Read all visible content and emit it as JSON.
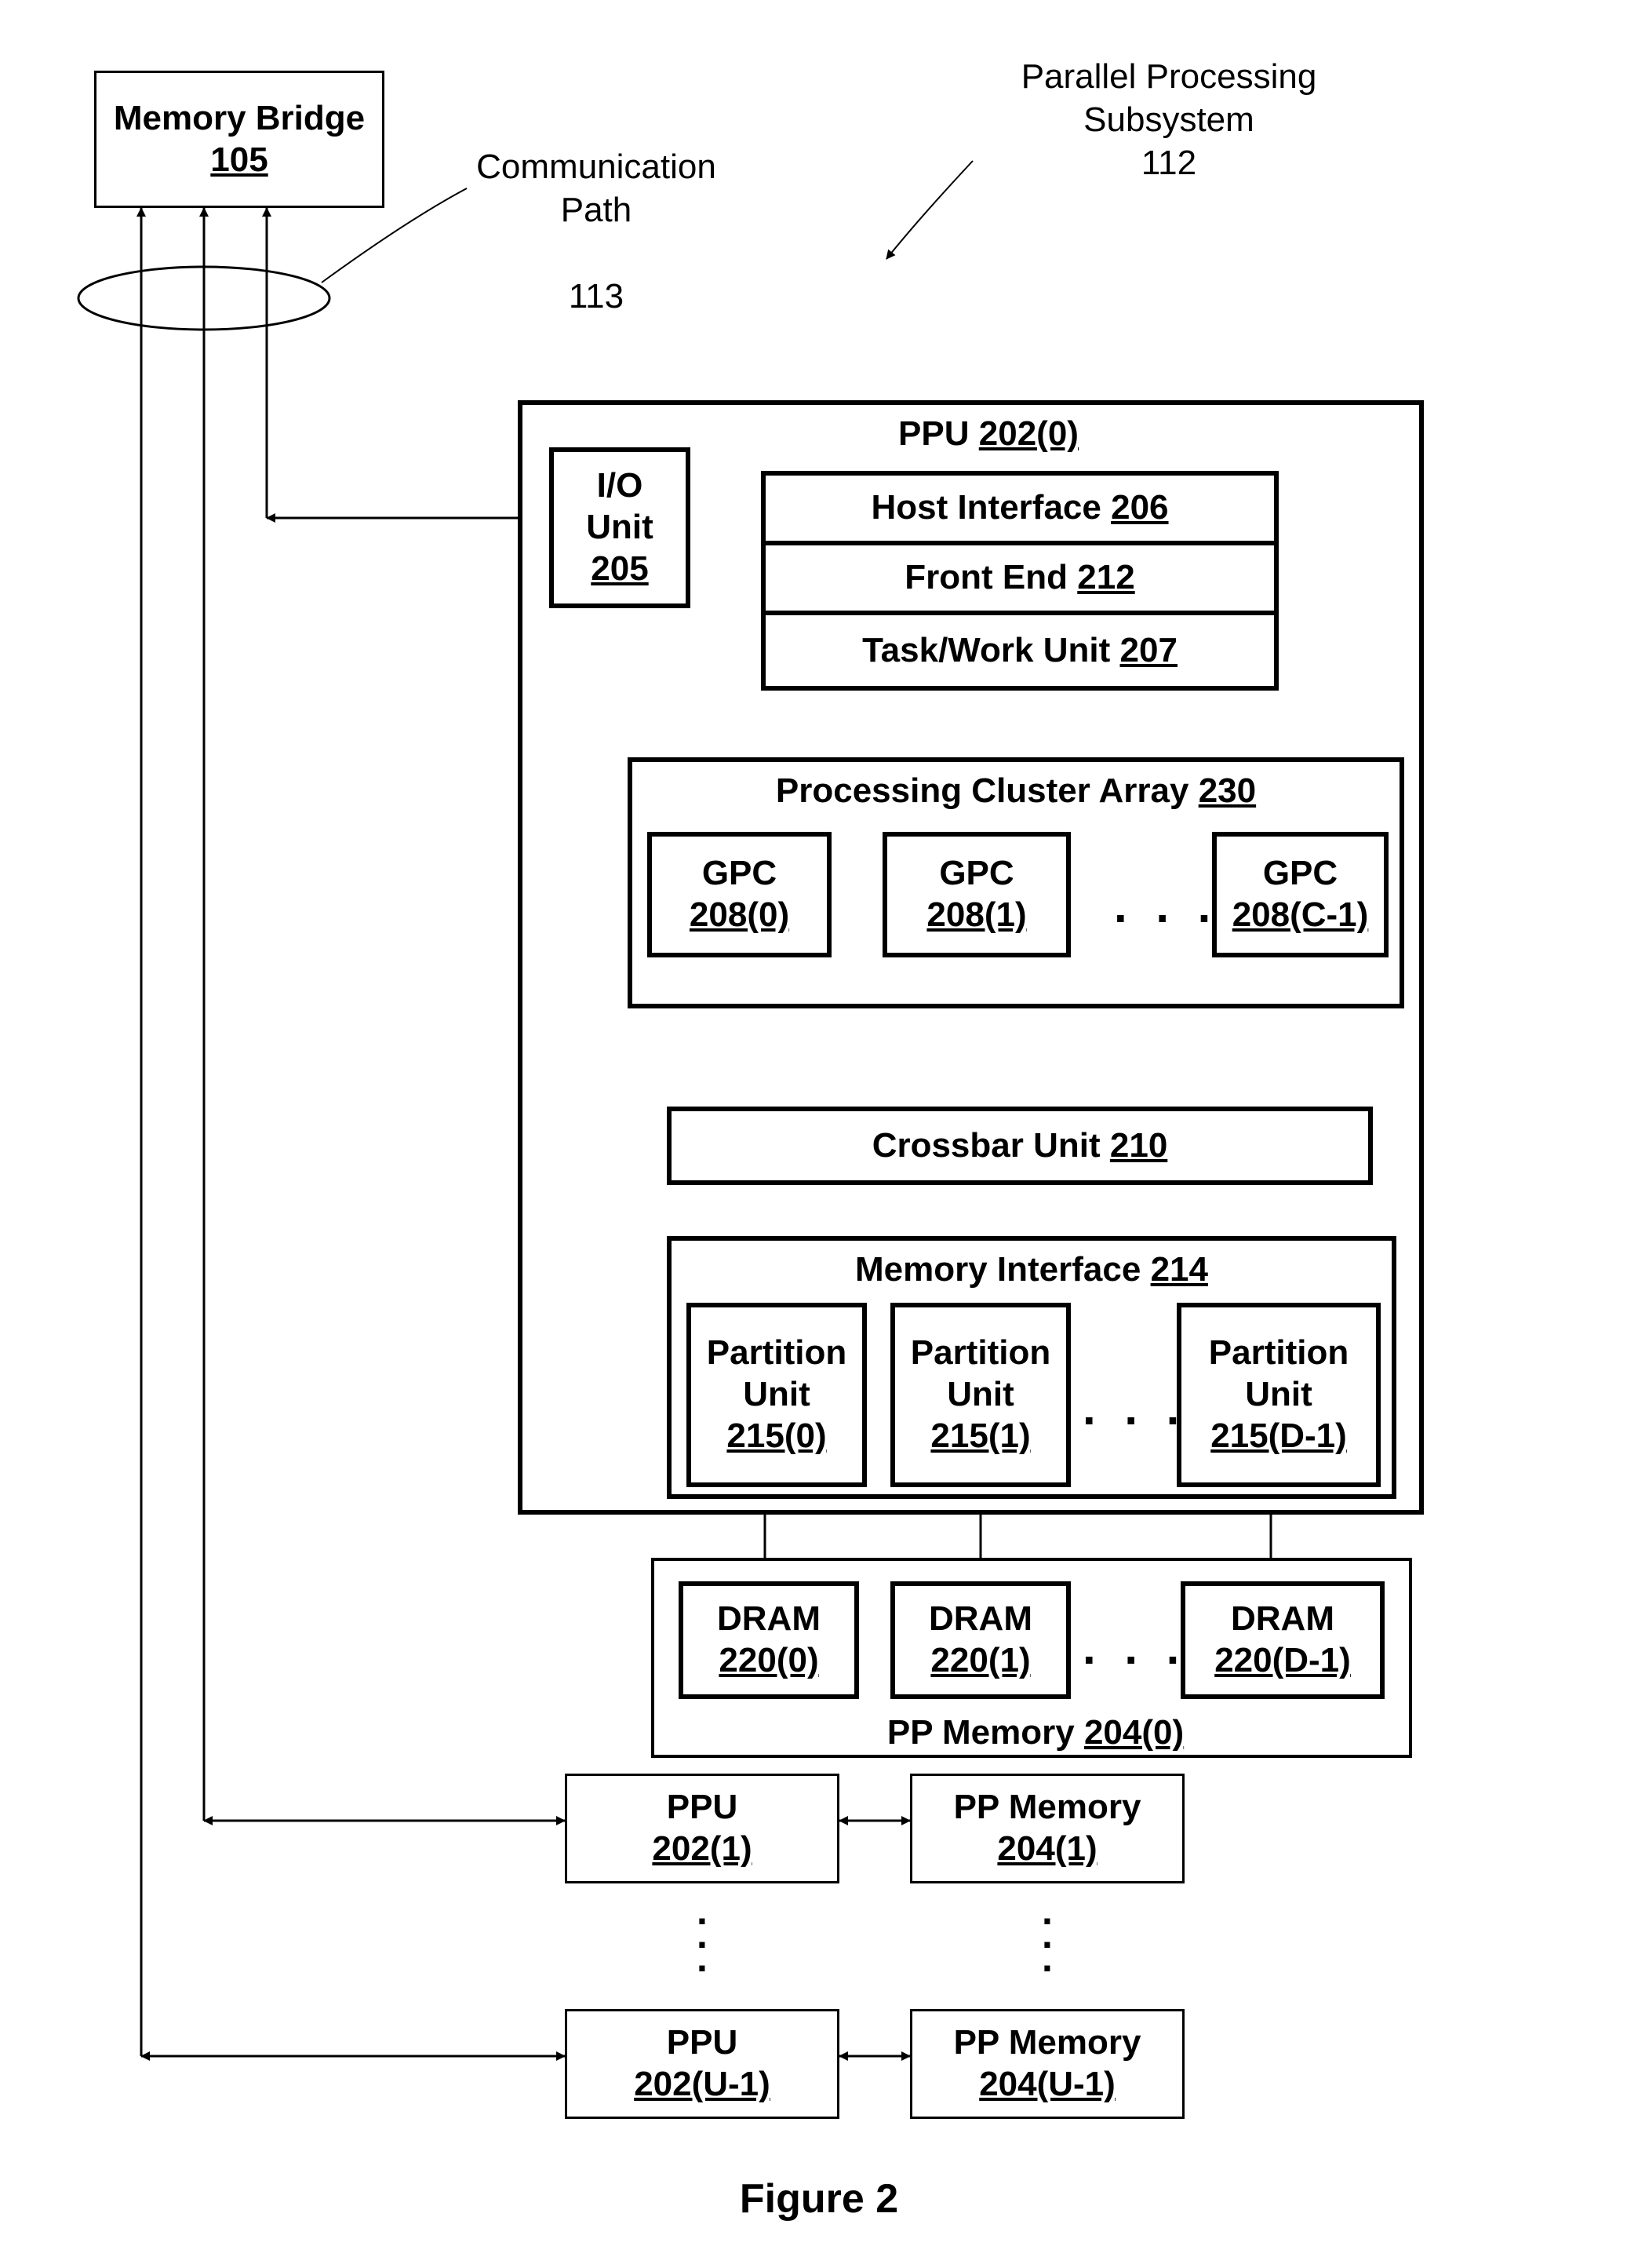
{
  "title": "Figure 2",
  "memory_bridge": {
    "name": "Memory Bridge",
    "ref": "105"
  },
  "comm_path": {
    "name": "Communication\nPath",
    "ref": "113"
  },
  "subsystem": {
    "name": "Parallel Processing\nSubsystem",
    "ref": "112"
  },
  "ppu0": {
    "name": "PPU",
    "ref": "202(0)",
    "io_unit": {
      "name": "I/O\nUnit",
      "ref": "205"
    },
    "host_interface": {
      "name": "Host Interface",
      "ref": "206"
    },
    "front_end": {
      "name": "Front End",
      "ref": "212"
    },
    "task_work": {
      "name": "Task/Work Unit",
      "ref": "207"
    },
    "pca": {
      "name": "Processing Cluster Array",
      "ref": "230",
      "gpc0": {
        "name": "GPC",
        "ref": "208(0)"
      },
      "gpc1": {
        "name": "GPC",
        "ref": "208(1)"
      },
      "gpcC": {
        "name": "GPC",
        "ref": "208(C-1)"
      }
    },
    "crossbar": {
      "name": "Crossbar Unit",
      "ref": "210"
    },
    "mem_if": {
      "name": "Memory Interface",
      "ref": "214",
      "pu0": {
        "name": "Partition\nUnit",
        "ref": "215(0)"
      },
      "pu1": {
        "name": "Partition\nUnit",
        "ref": "215(1)"
      },
      "puD": {
        "name": "Partition\nUnit",
        "ref": "215(D-1)"
      }
    }
  },
  "ppmem0": {
    "name": "PP Memory",
    "ref": "204(0)",
    "d0": {
      "name": "DRAM",
      "ref": "220(0)"
    },
    "d1": {
      "name": "DRAM",
      "ref": "220(1)"
    },
    "dD": {
      "name": "DRAM",
      "ref": "220(D-1)"
    }
  },
  "ppu1": {
    "name": "PPU",
    "ref": "202(1)"
  },
  "ppmem1": {
    "name": "PP Memory",
    "ref": "204(1)"
  },
  "ppuU": {
    "name": "PPU",
    "ref": "202(U-1)"
  },
  "ppmemU": {
    "name": "PP Memory",
    "ref": "204(U-1)"
  }
}
